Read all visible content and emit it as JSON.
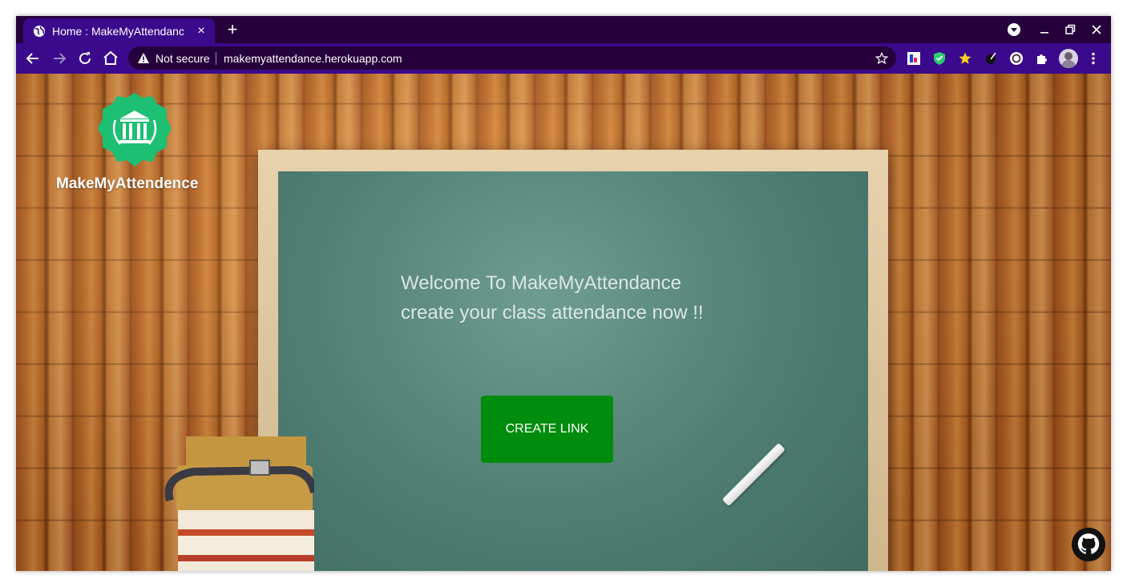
{
  "browser": {
    "tab_title": "Home : MakeMyAttendanc",
    "security_label": "Not secure",
    "url": "makemyattendance.herokuapp.com"
  },
  "page": {
    "brand": "MakeMyAttendence",
    "welcome_line1": "Welcome To MakeMyAttendance",
    "welcome_line2": "create your class attendance now !!",
    "cta_label": "CREATE LINK"
  },
  "colors": {
    "browser_frame": "#3b0a8c",
    "tab_strip": "#26003a",
    "logo_green": "#1dbf73",
    "cta_green": "#008c0c",
    "chalkboard": "#557f75"
  },
  "icons": [
    "globe-icon",
    "close-icon",
    "new-tab-icon",
    "back-icon",
    "forward-icon",
    "reload-icon",
    "home-icon",
    "warning-icon",
    "star-icon",
    "extensions-icon",
    "profile-avatar",
    "menu-icon",
    "github-icon"
  ]
}
